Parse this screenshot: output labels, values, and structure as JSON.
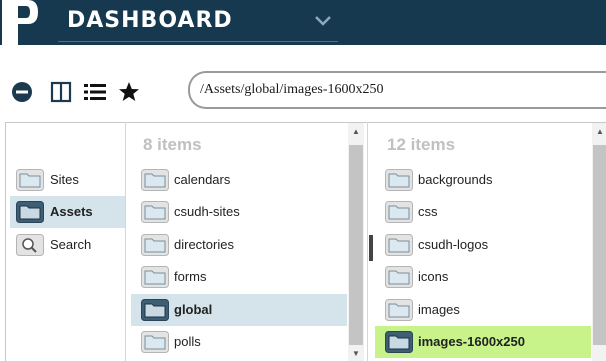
{
  "app": {
    "title": "DASHBOARD"
  },
  "toolbar": {
    "icons": [
      "collapse-icon",
      "columns-view-icon",
      "list-view-icon",
      "favorites-star-icon"
    ],
    "path": "/Assets/global/images-1600x250"
  },
  "sidebar": {
    "items": [
      {
        "label": "Sites",
        "icon": "folder-icon",
        "selected": false
      },
      {
        "label": "Assets",
        "icon": "folder-icon",
        "selected": true
      },
      {
        "label": "Search",
        "icon": "search-icon",
        "selected": false
      }
    ]
  },
  "column1": {
    "count": "8 items",
    "items": [
      {
        "label": "calendars"
      },
      {
        "label": "csudh-sites"
      },
      {
        "label": "directories"
      },
      {
        "label": "forms"
      },
      {
        "label": "global",
        "selected": true
      },
      {
        "label": "polls"
      }
    ]
  },
  "column2": {
    "count": "12 items",
    "items": [
      {
        "label": "backgrounds"
      },
      {
        "label": "css"
      },
      {
        "label": "csudh-logos"
      },
      {
        "label": "icons"
      },
      {
        "label": "images"
      },
      {
        "label": "images-1600x250",
        "selected": true
      }
    ]
  },
  "colors": {
    "topbar": "#16394f",
    "selected_blue": "#d4e4ea",
    "selected_green": "#c8f28a",
    "folder": "#dfe8ee",
    "folder_selected": "#3d5e74"
  }
}
